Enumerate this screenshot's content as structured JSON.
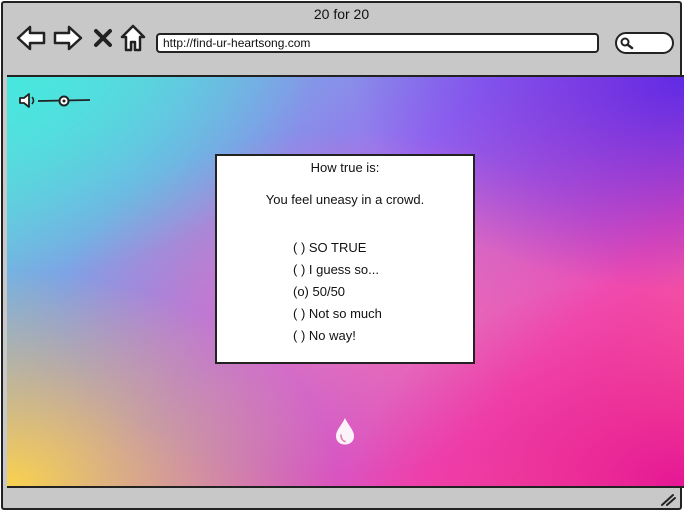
{
  "window": {
    "title": "20 for 20"
  },
  "toolbar": {
    "back_icon": "arrow-left-icon",
    "forward_icon": "arrow-right-icon",
    "stop_icon": "close-icon",
    "home_icon": "home-icon",
    "url": "http://find-ur-heartsong.com",
    "search_icon": "search-icon"
  },
  "page": {
    "volume_icon": "speaker-icon",
    "quiz": {
      "heading": "How true is:",
      "question": "You feel uneasy in a crowd.",
      "options": [
        {
          "label": "( ) SO TRUE",
          "selected": false
        },
        {
          "label": "( ) I guess so...",
          "selected": false
        },
        {
          "label": "(o) 50/50",
          "selected": true
        },
        {
          "label": "( ) Not so much",
          "selected": false
        },
        {
          "label": "( ) No way!",
          "selected": false
        }
      ]
    },
    "drop_icon": "water-drop-icon"
  },
  "colors": {
    "chrome": "#c8c8c8",
    "outline": "#222222",
    "gradient": [
      "#46e8de",
      "#5a28e6",
      "#ffd646",
      "#e41296"
    ]
  }
}
